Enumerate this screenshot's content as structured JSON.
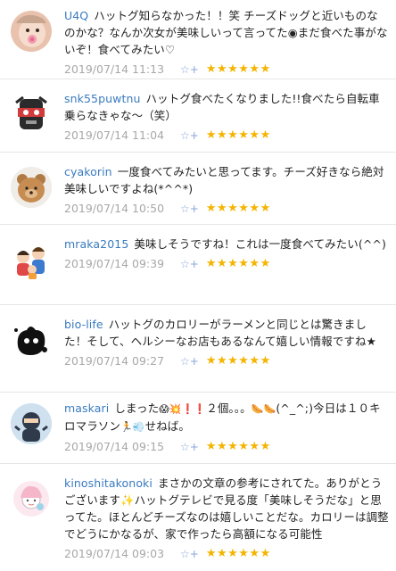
{
  "comments": [
    {
      "user": "U4Q",
      "text": "ハットグ知らなかった！！笑 チーズドッグと近いものなのかな？なんか次女が美味しいって言ってた◉まだ食べた事がないぞ！食べてみたい♡",
      "date": "2019/07/14 11:13",
      "stars": "★★★★★★",
      "avatar": "baby-photo"
    },
    {
      "user": "snk55puwtnu",
      "text": "ハットグ食べたくなりました!!食べたら自転車乗らなきゃな～（笑）",
      "date": "2019/07/14 11:04",
      "stars": "★★★★★★",
      "avatar": "robot-icon"
    },
    {
      "user": "cyakorin",
      "text": "一度食べてみたいと思ってます。チーズ好きなら絶対美味しいですよね(*^^*)",
      "date": "2019/07/14 10:50",
      "stars": "★★★★★★",
      "avatar": "teddy-bear"
    },
    {
      "user": "mraka2015",
      "text": "美味しそうですね！これは一度食べてみたい(^^)",
      "date": "2019/07/14 09:39",
      "stars": "★★★★★★",
      "avatar": "family-illustration"
    },
    {
      "user": "bio-life",
      "text": "ハットグのカロリーがラーメンと同じとは驚きました！そして、ヘルシーなお店もあるなんて嬉しい情報ですね★",
      "date": "2019/07/14 09:27",
      "stars": "★★★★★★",
      "avatar": "ink-cat"
    },
    {
      "user": "maskari",
      "text_parts": [
        "しまった",
        "😱",
        "💥",
        "❗",
        "❗",
        "２個。。。",
        "🌭",
        "🌭",
        "(^_^;)今日は１０キロマラソン",
        "🏃",
        "💨",
        "せねば。"
      ],
      "date": "2019/07/14 09:15",
      "stars": "★★★★★★",
      "avatar": "ninja-character"
    },
    {
      "user": "kinoshitakonoki",
      "text": "まさかの文章の参考にされてた。ありがとうございます✨ハットグテレビで見る度「美味しそうだな」と思ってた。ほとんどチーズなのは嬉しいことだな。カロリーは調整でどうにかなるが、家で作ったら高額になる可能性",
      "date": "2019/07/14 09:03",
      "stars": "★★★★★★",
      "avatar": "girl-sketch"
    }
  ],
  "addstar_icon": "☆+",
  "colors": {
    "username": "#3a7bbf",
    "star": "#f4b400",
    "date": "#a8a8a8",
    "addstar": "#8aa6d8"
  }
}
